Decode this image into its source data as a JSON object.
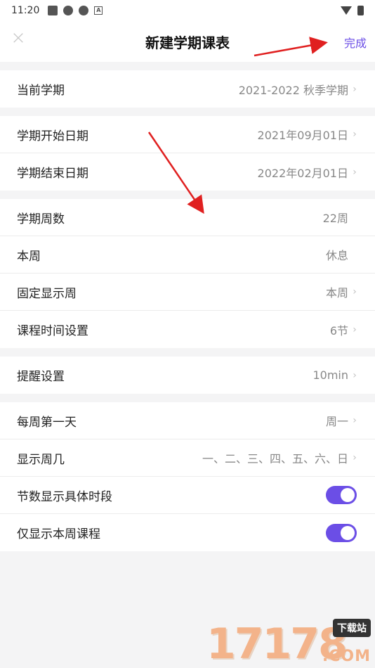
{
  "status": {
    "time": "11:20"
  },
  "header": {
    "title": "新建学期课表",
    "done_label": "完成"
  },
  "groups": [
    [
      {
        "label": "当前学期",
        "value": "2021-2022 秋季学期",
        "chevron": true
      }
    ],
    [
      {
        "label": "学期开始日期",
        "value": "2021年09月01日",
        "chevron": true
      },
      {
        "label": "学期结束日期",
        "value": "2022年02月01日",
        "chevron": true
      }
    ],
    [
      {
        "label": "学期周数",
        "value": "22周",
        "chevron": false
      },
      {
        "label": "本周",
        "value": "休息",
        "chevron": false
      },
      {
        "label": "固定显示周",
        "value": "本周",
        "chevron": true
      },
      {
        "label": "课程时间设置",
        "value": "6节",
        "chevron": true
      }
    ],
    [
      {
        "label": "提醒设置",
        "value": "10min",
        "chevron": true
      }
    ],
    [
      {
        "label": "每周第一天",
        "value": "周一",
        "chevron": true
      },
      {
        "label": "显示周几",
        "value": "一、二、三、四、五、六、日",
        "chevron": true
      },
      {
        "label": "节数显示具体时段",
        "toggle": true
      },
      {
        "label": "仅显示本周课程",
        "toggle": true
      }
    ]
  ],
  "watermark": {
    "number": "17178",
    "tag": "下载站",
    "domain": ".COM"
  },
  "colors": {
    "accent": "#6b4ee6",
    "arrow": "#e02020"
  }
}
